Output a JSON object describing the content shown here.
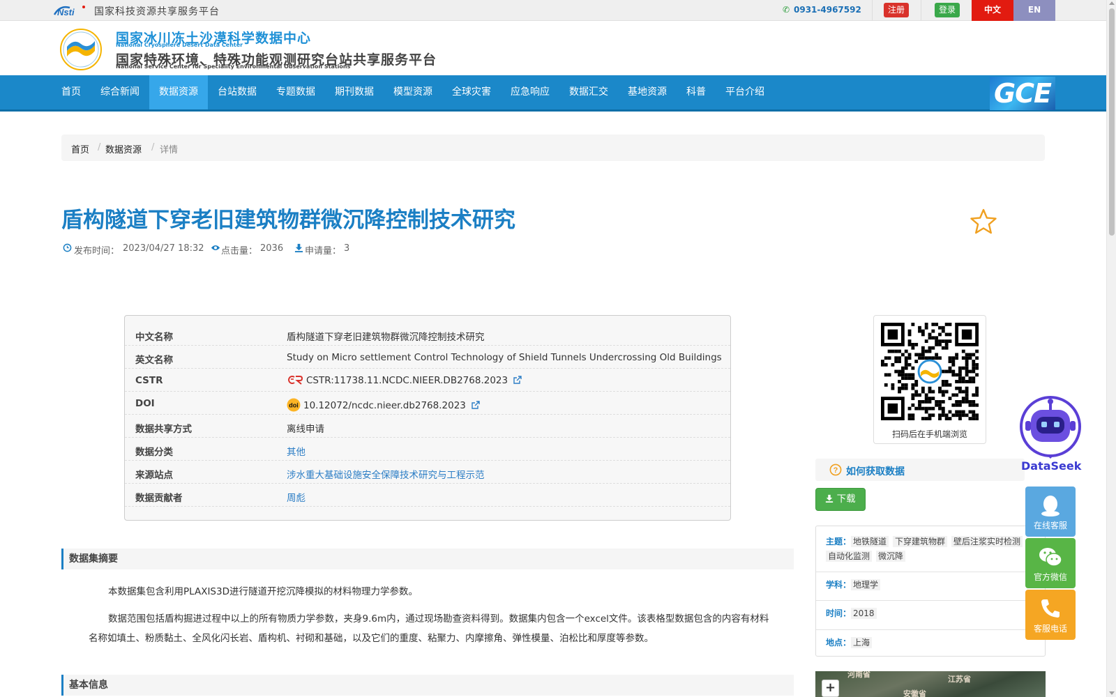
{
  "topbar": {
    "platform_name": "国家科技资源共享服务平台",
    "phone": "0931-4967592",
    "register": "注册",
    "login": "登录",
    "lang_zh": "中文",
    "lang_en": "EN"
  },
  "header": {
    "title_cn": "国家冰川冻土沙漠科学数据中心",
    "title_en": "National Cryosphere Desert Data Center",
    "subtitle_cn": "国家特殊环境、特殊功能观测研究台站共享服务平台",
    "subtitle_en": "National Service Center for Speciality Environmental Observation Stations"
  },
  "nav": {
    "items": [
      "首页",
      "综合新闻",
      "数据资源",
      "台站数据",
      "专题数据",
      "期刊数据",
      "模型资源",
      "全球灾害",
      "应急响应",
      "数据汇交",
      "基地资源",
      "科普",
      "平台介绍"
    ],
    "active": "数据资源",
    "brand": "GCE"
  },
  "breadcrumb": {
    "home": "首页",
    "section": "数据资源",
    "current": "详情",
    "sep": "/"
  },
  "dataset": {
    "title": "盾构隧道下穿老旧建筑物群微沉降控制技术研究",
    "publish_label": "发布时间：",
    "publish_time": "2023/04/27 18:32",
    "views_label": "点击量：",
    "views": "2036",
    "requests_label": "申请量：",
    "requests": "3"
  },
  "info": {
    "rows": [
      {
        "key": "中文名称",
        "value": "盾构隧道下穿老旧建筑物群微沉降控制技术研究"
      },
      {
        "key": "英文名称",
        "value": "Study on Micro settlement Control Technology of Shield Tunnels Undercrossing Old Buildings"
      },
      {
        "key": "CSTR",
        "value": "CSTR:11738.11.NCDC.NIEER.DB2768.2023"
      },
      {
        "key": "DOI",
        "value": "10.12072/ncdc.nieer.db2768.2023"
      },
      {
        "key": "数据共享方式",
        "value": "离线申请"
      },
      {
        "key": "数据分类",
        "value": "其他"
      },
      {
        "key": "来源站点",
        "value": "涉水重大基础设施安全保障技术研究与工程示范"
      },
      {
        "key": "数据贡献者",
        "value": "周彪"
      }
    ]
  },
  "summary": {
    "heading": "数据集摘要",
    "p1": "本数据集包含利用PLAXIS3D进行隧道开挖沉降模拟的材料物理力学参数。",
    "p2": "数据范围包括盾构掘进过程中以上的所有物质力学参数，夹身9.6m内，通过现场勘查资料得到。数据集内包含一个excel文件。该表格型数据包含的内容有材料名称如填土、粉质黏土、全风化闪长岩、盾构机、衬砌和基础，以及它们的重度、粘聚力、内摩擦角、弹性模量、泊松比和厚度等参数。"
  },
  "basic_info": {
    "heading": "基本信息"
  },
  "sidebar": {
    "qr_caption": "扫码后在手机端浏览",
    "howto": "如何获取数据",
    "download": "下载",
    "theme_label": "主题：",
    "themes": [
      "地铁隧道",
      "下穿建筑物群",
      "壁后注浆实时检测",
      "自动化监测",
      "微沉降"
    ],
    "discipline_label": "学科：",
    "discipline": "地理学",
    "time_label": "时间：",
    "time": "2018",
    "place_label": "地点：",
    "place": "上海",
    "map_labels": [
      "河南省",
      "江苏省",
      "安徽省"
    ],
    "map_zoom": "+"
  },
  "floating": {
    "dataseek": "DataSeek",
    "online_service": "在线客服",
    "wechat": "官方微信",
    "phone": "客服电话"
  },
  "colors": {
    "nav_bg": "#1b88c9",
    "nav_active": "#36a7ea",
    "title": "#1b7fc4",
    "register": "#d9322b",
    "login": "#3aa84a",
    "lang_zh": "#e21b10",
    "lang_en": "#8d8fbf"
  }
}
